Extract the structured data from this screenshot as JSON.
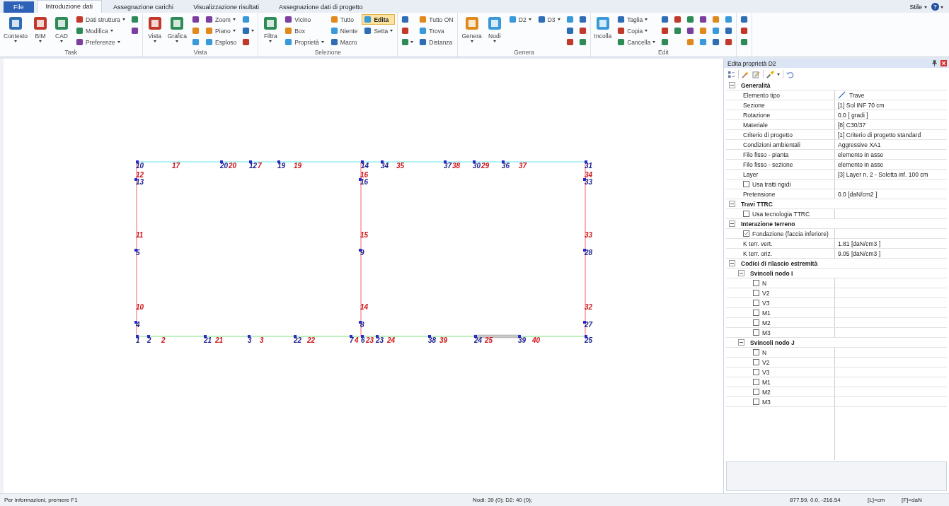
{
  "tabs": [
    {
      "label": "File",
      "kind": "file",
      "selected": false
    },
    {
      "label": "Introduzione dati",
      "kind": "tab",
      "selected": true
    },
    {
      "label": "Assegnazione carichi",
      "kind": "tab",
      "selected": false
    },
    {
      "label": "Visualizzazione risultati",
      "kind": "tab",
      "selected": false
    },
    {
      "label": "Assegnazione dati di progetto",
      "kind": "tab",
      "selected": false
    }
  ],
  "style_menu": {
    "label": "Stile",
    "help": "?"
  },
  "ribbon": [
    {
      "label": "Task",
      "columns": [
        {
          "kind": "large",
          "items": [
            {
              "label": "Contesto",
              "dropdown": true
            },
            {
              "label": "BIM",
              "dropdown": true
            },
            {
              "label": "CAD",
              "dropdown": true
            }
          ]
        },
        {
          "kind": "small",
          "items": [
            {
              "label": "Dati struttura",
              "dropdown": true,
              "selected": false
            },
            {
              "label": "Modifica",
              "dropdown": true,
              "selected": false
            },
            {
              "label": "Preferenze",
              "dropdown": true,
              "selected": false
            }
          ]
        },
        {
          "kind": "icons",
          "items": [
            {
              "dropdown": false
            },
            {
              "dropdown": false
            }
          ]
        }
      ]
    },
    {
      "label": "Vista",
      "columns": [
        {
          "kind": "large",
          "items": [
            {
              "label": "Vista",
              "dropdown": true
            },
            {
              "label": "Grafica",
              "dropdown": true
            }
          ]
        },
        {
          "kind": "icons",
          "items": [
            {
              "dropdown": false
            },
            {
              "dropdown": false
            },
            {
              "dropdown": false
            }
          ]
        },
        {
          "kind": "small",
          "items": [
            {
              "label": "Zoom",
              "dropdown": true,
              "selected": false
            },
            {
              "label": "Piano",
              "dropdown": true,
              "selected": false
            },
            {
              "label": "Esploso",
              "dropdown": false,
              "selected": false
            }
          ]
        },
        {
          "kind": "icons",
          "items": [
            {
              "dropdown": false
            },
            {
              "dropdown": true
            },
            {
              "dropdown": false
            }
          ]
        }
      ]
    },
    {
      "label": "Selezione",
      "columns": [
        {
          "kind": "large",
          "items": [
            {
              "label": "Filtra",
              "dropdown": true
            }
          ]
        },
        {
          "kind": "small",
          "items": [
            {
              "label": "Vicino",
              "dropdown": false,
              "selected": false
            },
            {
              "label": "Box",
              "dropdown": false,
              "selected": false
            },
            {
              "label": "Proprietà",
              "dropdown": true,
              "selected": false
            }
          ]
        },
        {
          "kind": "small",
          "items": [
            {
              "label": "Tutto",
              "dropdown": false,
              "selected": false
            },
            {
              "label": "Niente",
              "dropdown": false,
              "selected": false
            },
            {
              "label": "Macro",
              "dropdown": false,
              "selected": false
            }
          ]
        },
        {
          "kind": "small",
          "items": [
            {
              "label": "Edita",
              "dropdown": false,
              "selected": true
            },
            {
              "label": "Setta",
              "dropdown": true,
              "selected": false
            }
          ]
        }
      ]
    },
    {
      "columns": [
        {
          "kind": "icons",
          "items": [
            {
              "dropdown": false
            },
            {
              "dropdown": false
            },
            {
              "dropdown": true
            }
          ]
        },
        {
          "kind": "small",
          "items": [
            {
              "label": "Tutto ON",
              "dropdown": false,
              "selected": false
            },
            {
              "label": "Trova",
              "dropdown": false,
              "selected": false
            },
            {
              "label": "Distanza",
              "dropdown": false,
              "selected": false
            }
          ]
        }
      ]
    },
    {
      "label": "Genera",
      "columns": [
        {
          "kind": "large",
          "items": [
            {
              "label": "Genera",
              "dropdown": true
            },
            {
              "label": "Nodi",
              "dropdown": true
            }
          ]
        },
        {
          "kind": "small",
          "items": [
            {
              "label": "D2",
              "dropdown": true,
              "selected": false
            }
          ]
        },
        {
          "kind": "small",
          "items": [
            {
              "label": "D3",
              "dropdown": true,
              "selected": false
            }
          ]
        },
        {
          "kind": "icons",
          "items": [
            {
              "dropdown": false
            },
            {
              "dropdown": false
            },
            {
              "dropdown": false
            }
          ]
        },
        {
          "kind": "icons",
          "items": [
            {
              "dropdown": false
            },
            {
              "dropdown": false
            },
            {
              "dropdown": false
            }
          ]
        }
      ]
    },
    {
      "label": "Edit",
      "columns": [
        {
          "kind": "large",
          "items": [
            {
              "label": "Incolla",
              "dropdown": false
            }
          ]
        },
        {
          "kind": "small",
          "items": [
            {
              "label": "Taglia",
              "dropdown": true,
              "selected": false
            },
            {
              "label": "Copia",
              "dropdown": true,
              "selected": false
            },
            {
              "label": "Cancella",
              "dropdown": true,
              "selected": false
            }
          ]
        },
        {
          "kind": "icons",
          "items": [
            {
              "dropdown": false
            },
            {
              "dropdown": false
            },
            {
              "dropdown": false
            }
          ]
        },
        {
          "kind": "icons",
          "items": [
            {
              "dropdown": false
            },
            {
              "dropdown": false
            }
          ]
        },
        {
          "kind": "icons",
          "items": [
            {
              "dropdown": false
            },
            {
              "dropdown": false
            },
            {
              "dropdown": false
            }
          ]
        },
        {
          "kind": "icons",
          "items": [
            {
              "dropdown": false
            },
            {
              "dropdown": false
            },
            {
              "dropdown": false
            }
          ]
        },
        {
          "kind": "icons",
          "items": [
            {
              "dropdown": false
            },
            {
              "dropdown": false
            },
            {
              "dropdown": false
            }
          ]
        },
        {
          "kind": "icons",
          "items": [
            {
              "dropdown": false
            },
            {
              "dropdown": false
            },
            {
              "dropdown": false
            }
          ]
        }
      ]
    },
    {
      "columns": [
        {
          "kind": "icons",
          "items": [
            {
              "dropdown": false
            },
            {
              "dropdown": false
            },
            {
              "dropdown": false
            }
          ]
        }
      ]
    }
  ],
  "canvas": {
    "labels": [
      {
        "text": "10",
        "kind": "node"
      },
      {
        "text": "17",
        "kind": "element"
      },
      {
        "text": "20",
        "kind": "node"
      },
      {
        "text": "20",
        "kind": "element"
      },
      {
        "text": "12",
        "kind": "node"
      },
      {
        "text": "7",
        "kind": "element"
      },
      {
        "text": "19",
        "kind": "node"
      },
      {
        "text": "19",
        "kind": "element"
      },
      {
        "text": "14",
        "kind": "node"
      },
      {
        "text": "34",
        "kind": "node"
      },
      {
        "text": "35",
        "kind": "element"
      },
      {
        "text": "37",
        "kind": "node"
      },
      {
        "text": "38",
        "kind": "element"
      },
      {
        "text": "30",
        "kind": "node"
      },
      {
        "text": "29",
        "kind": "element"
      },
      {
        "text": "36",
        "kind": "node"
      },
      {
        "text": "37",
        "kind": "element"
      },
      {
        "text": "31",
        "kind": "node"
      },
      {
        "text": "12",
        "kind": "element"
      },
      {
        "text": "13",
        "kind": "node"
      },
      {
        "text": "11",
        "kind": "element"
      },
      {
        "text": "5",
        "kind": "node"
      },
      {
        "text": "10",
        "kind": "element"
      },
      {
        "text": "4",
        "kind": "node"
      },
      {
        "text": "16",
        "kind": "element"
      },
      {
        "text": "16",
        "kind": "node"
      },
      {
        "text": "15",
        "kind": "element"
      },
      {
        "text": "9",
        "kind": "node"
      },
      {
        "text": "14",
        "kind": "element"
      },
      {
        "text": "8",
        "kind": "node"
      },
      {
        "text": "34",
        "kind": "element"
      },
      {
        "text": "33",
        "kind": "node"
      },
      {
        "text": "33",
        "kind": "element"
      },
      {
        "text": "28",
        "kind": "node"
      },
      {
        "text": "32",
        "kind": "element"
      },
      {
        "text": "27",
        "kind": "node"
      },
      {
        "text": "1",
        "kind": "node"
      },
      {
        "text": "2",
        "kind": "node"
      },
      {
        "text": "2",
        "kind": "element"
      },
      {
        "text": "21",
        "kind": "node"
      },
      {
        "text": "21",
        "kind": "element"
      },
      {
        "text": "3",
        "kind": "node"
      },
      {
        "text": "3",
        "kind": "element"
      },
      {
        "text": "22",
        "kind": "node"
      },
      {
        "text": "22",
        "kind": "element"
      },
      {
        "text": "7",
        "kind": "node"
      },
      {
        "text": "4",
        "kind": "element"
      },
      {
        "text": "6",
        "kind": "node"
      },
      {
        "text": "23",
        "kind": "element"
      },
      {
        "text": "23",
        "kind": "node"
      },
      {
        "text": "24",
        "kind": "element"
      },
      {
        "text": "38",
        "kind": "node"
      },
      {
        "text": "39",
        "kind": "element"
      },
      {
        "text": "24",
        "kind": "node"
      },
      {
        "text": "25",
        "kind": "element"
      },
      {
        "text": "39",
        "kind": "node"
      },
      {
        "text": "40",
        "kind": "element"
      },
      {
        "text": "25",
        "kind": "node"
      }
    ]
  },
  "properties": {
    "title": "Edita proprietà D2",
    "categories": [
      {
        "label": "Generalità",
        "expanded": true,
        "children": [
          {
            "kind": "element_type",
            "label": "Elemento tipo",
            "value": "Trave"
          },
          {
            "kind": "property",
            "label": "Sezione",
            "value": "[1] Sol INF 70 cm"
          },
          {
            "kind": "property",
            "label": "Rotazione",
            "value": "0.0  [ gradi ]"
          },
          {
            "kind": "property",
            "label": "Materiale",
            "value": "[8] C30/37"
          },
          {
            "kind": "property",
            "label": "Criterio di progetto",
            "value": "[1] Criterio di progetto standard"
          },
          {
            "kind": "property",
            "label": "Condizioni ambientali",
            "value": "Aggressive XA1"
          },
          {
            "kind": "property",
            "label": "Filo fisso - pianta",
            "value": "elemento in asse"
          },
          {
            "kind": "property",
            "label": "Filo fisso - sezione",
            "value": "elemento in asse"
          },
          {
            "kind": "property",
            "label": "Layer",
            "value": "[3] Layer n. 2 - Soletta inf. 100 cm"
          },
          {
            "kind": "check",
            "label": "Usa tratti rigidi",
            "checked": false
          },
          {
            "kind": "property",
            "label": "Pretensione",
            "value": "0.0  [daN/cm2 ]"
          }
        ]
      },
      {
        "label": "Travi TTRC",
        "expanded": true,
        "children": [
          {
            "kind": "check",
            "label": "Usa tecnologia TTRC",
            "checked": false
          }
        ]
      },
      {
        "label": "Interazione terreno",
        "expanded": true,
        "children": [
          {
            "kind": "check",
            "label": "Fondazione (faccia inferiore)",
            "checked": true
          },
          {
            "kind": "property",
            "label": "K terr. vert.",
            "value": "1.81  [daN/cm3 ]"
          },
          {
            "kind": "property",
            "label": "K terr. oriz.",
            "value": "9.05  [daN/cm3 ]"
          }
        ]
      },
      {
        "label": "Codici di rilascio estremità",
        "expanded": true,
        "children": [
          {
            "kind": "group",
            "label": "Svincoli nodo I",
            "expanded": true,
            "children": [
              {
                "kind": "check",
                "label": "N",
                "checked": false
              },
              {
                "kind": "check",
                "label": "V2",
                "checked": false
              },
              {
                "kind": "check",
                "label": "V3",
                "checked": false
              },
              {
                "kind": "check",
                "label": "M1",
                "checked": false
              },
              {
                "kind": "check",
                "label": "M2",
                "checked": false
              },
              {
                "kind": "check",
                "label": "M3",
                "checked": false
              }
            ]
          },
          {
            "kind": "group",
            "label": "Svincoli nodo J",
            "expanded": true,
            "children": [
              {
                "kind": "check",
                "label": "N",
                "checked": false
              },
              {
                "kind": "check",
                "label": "V2",
                "checked": false
              },
              {
                "kind": "check",
                "label": "V3",
                "checked": false
              },
              {
                "kind": "check",
                "label": "M1",
                "checked": false
              },
              {
                "kind": "check",
                "label": "M2",
                "checked": false
              },
              {
                "kind": "check",
                "label": "M3",
                "checked": false
              }
            ]
          }
        ]
      }
    ]
  },
  "status_bar": {
    "hint": "Per informazioni, premere F1",
    "counts": "Nodi: 39 (0); D2: 40 (0);",
    "coordinates": "877.59, 0.0, -216.54",
    "length_unit": "[L]=cm",
    "force_unit": "[F]=daN"
  }
}
